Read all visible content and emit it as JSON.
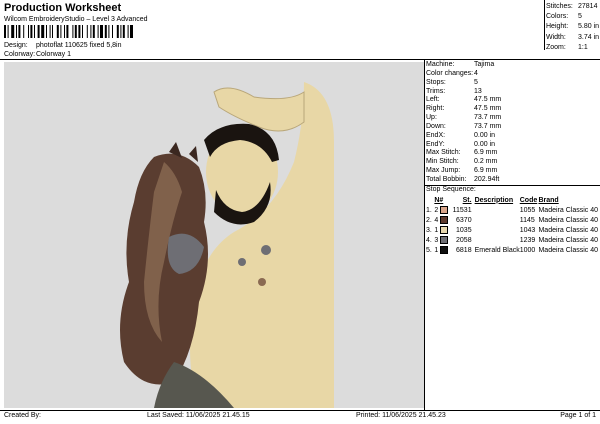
{
  "header": {
    "title": "Production Worksheet",
    "subtitle": "Wilcom EmbroideryStudio – Level 3 Advanced",
    "design_label": "Design:",
    "design_value": "photoflat 110625 fixed 5,8in",
    "colorway_label": "Colorway:",
    "colorway_value": "Colorway 1"
  },
  "stats": [
    {
      "label": "Stitches:",
      "value": "27814"
    },
    {
      "label": "Colors:",
      "value": "5"
    },
    {
      "label": "Height:",
      "value": "5.80 in"
    },
    {
      "label": "Width:",
      "value": "3.74 in"
    },
    {
      "label": "Zoom:",
      "value": "1:1"
    }
  ],
  "info": [
    {
      "label": "Machine:",
      "value": "Tajima"
    },
    {
      "label": "Color changes:",
      "value": "4"
    },
    {
      "label": "Stops:",
      "value": "5"
    },
    {
      "label": "Trims:",
      "value": "13"
    },
    {
      "label": "Left:",
      "value": "47.5 mm"
    },
    {
      "label": "Right:",
      "value": "47.5 mm"
    },
    {
      "label": "Up:",
      "value": "73.7 mm"
    },
    {
      "label": "Down:",
      "value": "73.7 mm"
    },
    {
      "label": "EndX:",
      "value": "0.00 in"
    },
    {
      "label": "EndY:",
      "value": "0.00 in"
    },
    {
      "label": "Max Stitch:",
      "value": "6.9 mm"
    },
    {
      "label": "Min Stitch:",
      "value": "0.2 mm"
    },
    {
      "label": "Max Jump:",
      "value": "6.9 mm"
    },
    {
      "label": "Total Bobbin:",
      "value": "202.94ft"
    }
  ],
  "stop_sequence": {
    "title": "Stop Sequence:",
    "headers": {
      "n": "N#",
      "st": "St.",
      "description": "Description",
      "code": "Code",
      "brand": "Brand"
    },
    "rows": [
      {
        "idx": "1.",
        "n": "2",
        "color": "#d9a58a",
        "st": "11531",
        "description": "",
        "code": "1055",
        "brand": "Madeira Classic 40"
      },
      {
        "idx": "2.",
        "n": "4",
        "color": "#5e3a2e",
        "st": "6370",
        "description": "",
        "code": "1145",
        "brand": "Madeira Classic 40"
      },
      {
        "idx": "3.",
        "n": "1",
        "color": "#e6d6ad",
        "st": "1035",
        "description": "",
        "code": "1043",
        "brand": "Madeira Classic 40"
      },
      {
        "idx": "4.",
        "n": "3",
        "color": "#6e6e74",
        "st": "2058",
        "description": "",
        "code": "1239",
        "brand": "Madeira Classic 40"
      },
      {
        "idx": "5.",
        "n": "1",
        "color": "#111111",
        "st": "6818",
        "description": "Emerald Black",
        "code": "1000",
        "brand": "Madeira Classic 40"
      }
    ]
  },
  "footer": {
    "created_by": "Created By:",
    "last_saved": "Last Saved: 11/06/2025 21.45.15",
    "printed": "Printed: 11/06/2025 21.45.23",
    "page": "Page 1 of 1"
  },
  "colors": {
    "preview_bg": "#dcdcdc",
    "skin": "#e8d7a6",
    "beard": "#1a1410",
    "fur_dark": "#5a3d30",
    "fur_light": "#8a6a52",
    "pants": "#57574f"
  }
}
